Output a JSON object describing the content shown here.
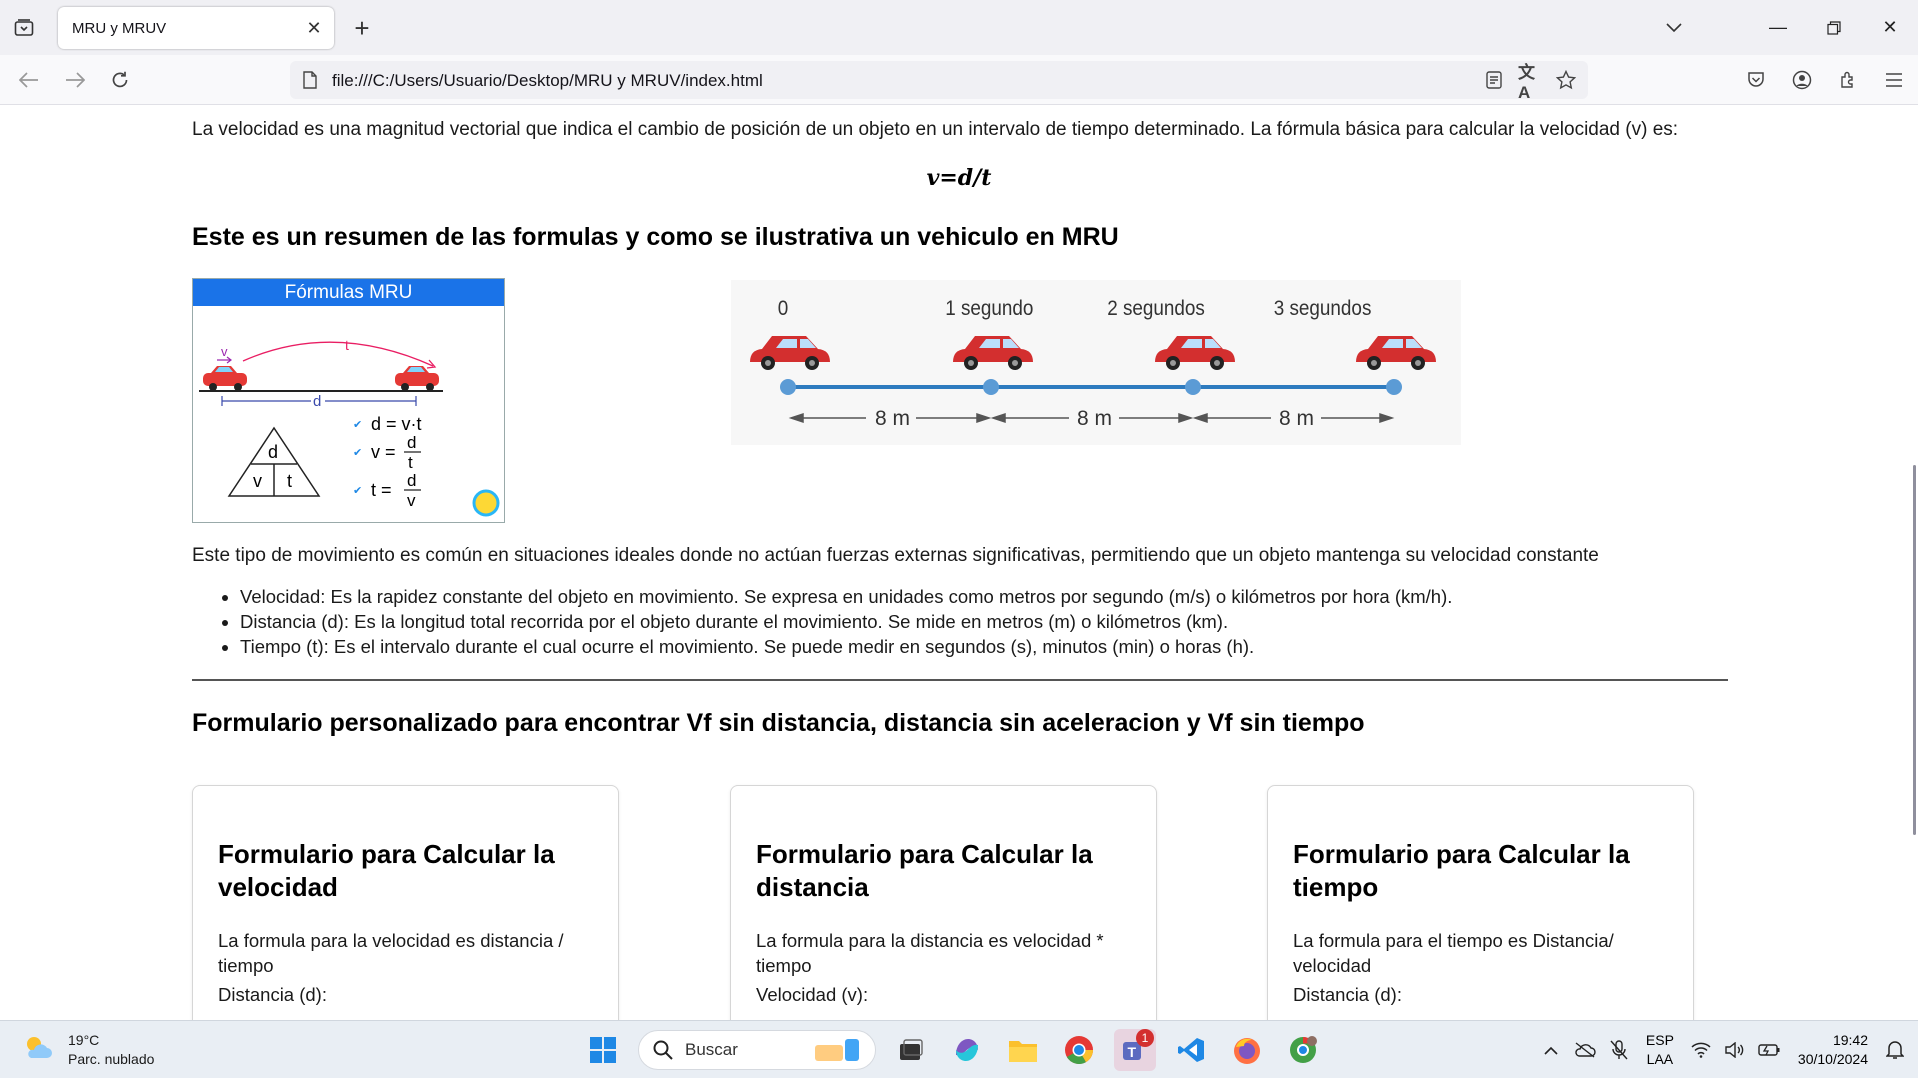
{
  "browser": {
    "tab_title": "MRU y MRUV",
    "url": "file:///C:/Users/Usuario/Desktop/MRU y MRUV/index.html"
  },
  "page": {
    "intro": "La velocidad es una magnitud vectorial que indica el cambio de posición de un objeto en un intervalo de tiempo determinado. La fórmula básica para calcular la velocidad (v) es:",
    "formula": "v=d/t",
    "heading1": "Este es un resumen de las formulas y como se ilustrativa un vehiculo en MRU",
    "formulas_card": {
      "title": "Fórmulas MRU",
      "v_label": "v",
      "t_label": "t",
      "d_label": "d",
      "tri_top": "d",
      "tri_left": "v",
      "tri_right": "t",
      "f1": "d = v·t",
      "f2_lhs": "v =",
      "f2_num": "d",
      "f2_den": "t",
      "f3_lhs": "t =",
      "f3_num": "d",
      "f3_den": "v"
    },
    "road": {
      "labels": [
        "0",
        "1 segundo",
        "2 segundos",
        "3 segundos"
      ],
      "distances": [
        "8 m",
        "8 m",
        "8 m"
      ]
    },
    "para2": "Este tipo de movimiento es común en situaciones ideales donde no actúan fuerzas externas significativas, permitiendo que un objeto mantenga su velocidad constante",
    "bullets": [
      "Velocidad: Es la rapidez constante del objeto en movimiento. Se expresa en unidades como metros por segundo (m/s) o kilómetros por hora (km/h).",
      "Distancia (d): Es la longitud total recorrida por el objeto durante el movimiento. Se mide en metros (m) o kilómetros (km).",
      "Tiempo (t): Es el intervalo durante el cual ocurre el movimiento. Se puede medir en segundos (s), minutos (min) o horas (h)."
    ],
    "heading2": "Formulario personalizado para encontrar Vf sin distancia, distancia sin aceleracion y Vf sin tiempo",
    "cards": [
      {
        "title": "Formulario para Calcular la velocidad",
        "desc": "La formula para la velocidad es distancia / tiempo",
        "field": "Distancia (d):"
      },
      {
        "title": "Formulario para Calcular la distancia",
        "desc": "La formula para la distancia es velocidad * tiempo",
        "field": "Velocidad (v):"
      },
      {
        "title": "Formulario para Calcular la tiempo",
        "desc": "La formula para el tiempo es Distancia/ velocidad",
        "field": "Distancia (d):"
      }
    ]
  },
  "taskbar": {
    "temp": "19°C",
    "weather": "Parc. nublado",
    "search": "Buscar",
    "teams_badge": "1",
    "lang1": "ESP",
    "lang2": "LAA",
    "time": "19:42",
    "date": "30/10/2024"
  },
  "colors": {
    "accent": "#1a73e8",
    "road": "#2e7bbf",
    "car": "#d32f2f"
  }
}
